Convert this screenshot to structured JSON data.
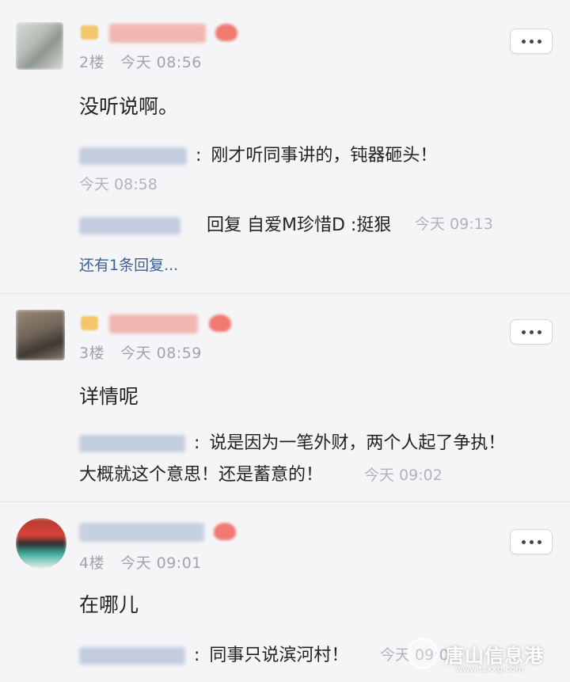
{
  "posts": [
    {
      "floor": "2楼",
      "time": "今天 08:56",
      "content": "没听说啊。",
      "replies": [
        {
          "separator": ":",
          "text": "刚才听同事讲的，钝器砸头！",
          "time": "今天 08:58"
        },
        {
          "text": "回复 自爱M珍惜D :挺狠",
          "time": "今天 09:13"
        }
      ],
      "more_replies": "还有1条回复..."
    },
    {
      "floor": "3楼",
      "time": "今天 08:59",
      "content": "详情呢",
      "replies": [
        {
          "separator": ":",
          "text": "说是因为一笔外财，两个人起了争执！",
          "text2": "大概就这个意思！还是蓄意的！",
          "time": "今天 09:02"
        }
      ]
    },
    {
      "floor": "4楼",
      "time": "今天 09:01",
      "content": "在哪儿",
      "replies": [
        {
          "separator": ":",
          "text": "同事只说滨河村！",
          "time": "今天 09:0"
        }
      ]
    }
  ],
  "watermark": {
    "name": "唐山信息港",
    "url": "www.tsxxg.com"
  },
  "colors": {
    "background": "#f5f5f7",
    "link": "#3d5f94",
    "meta": "#a3a3ad"
  }
}
